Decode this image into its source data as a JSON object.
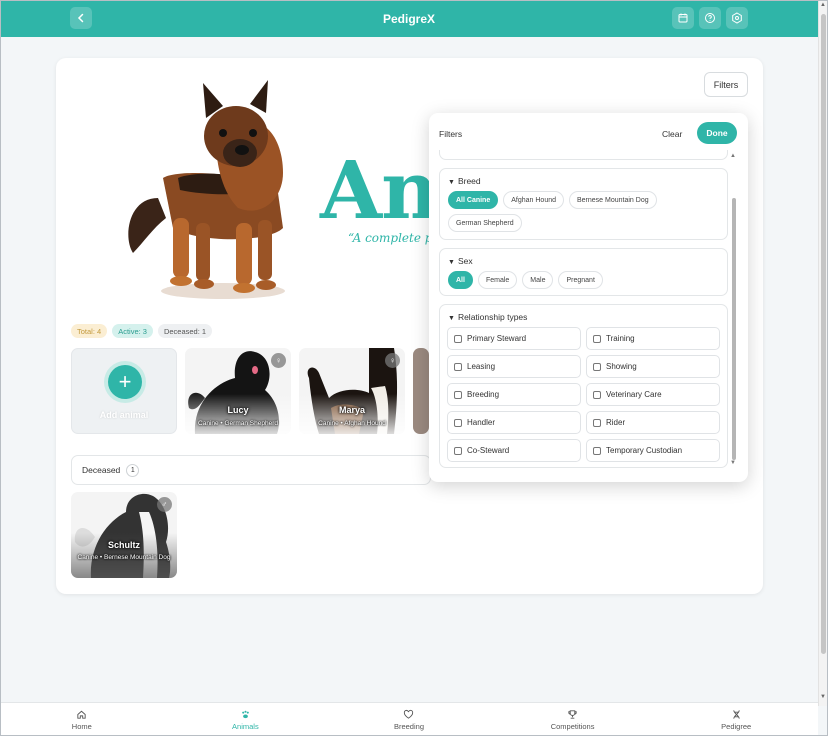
{
  "app": {
    "title": "PedigreX"
  },
  "header": {
    "filters_label": "Filters"
  },
  "hero": {
    "title": "An",
    "subtitle": "“A complete pro"
  },
  "stats": {
    "total": "Total: 4",
    "active": "Active: 3",
    "deceased": "Deceased: 1"
  },
  "add_animal": {
    "label": "Add animal"
  },
  "animals": [
    {
      "name": "Lucy",
      "info": "Canine • German Shepherd",
      "sex": "♀"
    },
    {
      "name": "Marya",
      "info": "Canine • Afghan Hound",
      "sex": "♀"
    }
  ],
  "deceased_section": {
    "label": "Deceased",
    "count": "1"
  },
  "deceased_animals": [
    {
      "name": "Schultz",
      "info": "Canine • Bernese Mountain Dog",
      "sex": "♂"
    }
  ],
  "filter_panel": {
    "title": "Filters",
    "clear_label": "Clear",
    "done_label": "Done",
    "breed": {
      "title": "Breed",
      "options": [
        "All Canine",
        "Afghan Hound",
        "Bernese Mountain Dog",
        "German Shepherd"
      ],
      "selected": "All Canine"
    },
    "sex": {
      "title": "Sex",
      "options": [
        "All",
        "Female",
        "Male",
        "Pregnant"
      ],
      "selected": "All"
    },
    "relationship": {
      "title": "Relationship types",
      "options": [
        "Primary Steward",
        "Training",
        "Leasing",
        "Showing",
        "Breeding",
        "Veterinary Care",
        "Handler",
        "Rider",
        "Co-Steward",
        "Temporary Custodian"
      ]
    }
  },
  "nav": {
    "home": "Home",
    "animals": "Animals",
    "breeding": "Breeding",
    "competitions": "Competitions",
    "pedigree": "Pedigree",
    "active": "Animals"
  },
  "colors": {
    "accent": "#2fb5a8",
    "total_badge": "#fbeed3",
    "active_badge": "#d5f1ed"
  },
  "icons": {
    "back": "chevron-left-icon",
    "calendar": "calendar-icon",
    "help": "help-circle-icon",
    "settings": "hexagon-icon"
  }
}
